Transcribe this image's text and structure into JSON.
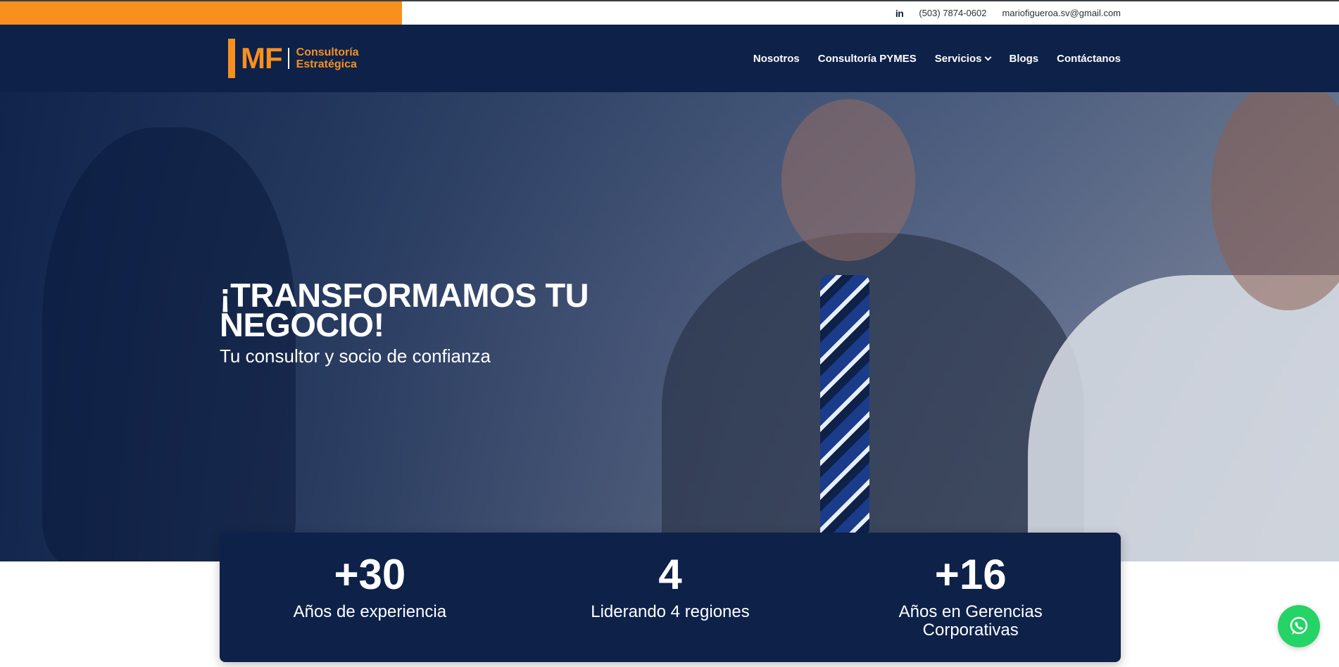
{
  "topbar": {
    "linkedin_icon": "in",
    "phone": "(503) 7874-0602",
    "email": "mariofigueroa.sv@gmail.com"
  },
  "header": {
    "logo": {
      "mark": "MF",
      "line1": "Consultoría",
      "line2": "Estratégica"
    },
    "nav": [
      {
        "label": "Nosotros"
      },
      {
        "label": "Consultoría PYMES"
      },
      {
        "label": "Servicios",
        "has_dropdown": true
      },
      {
        "label": "Blogs"
      },
      {
        "label": "Contáctanos"
      }
    ]
  },
  "hero": {
    "title": "¡TRANSFORMAMOS TU NEGOCIO!",
    "subtitle": "Tu consultor y socio de confianza"
  },
  "stats": [
    {
      "number": "+30",
      "label": "Años de experiencia"
    },
    {
      "number": "4",
      "label": "Liderando 4 regiones"
    },
    {
      "number": "+16",
      "label": "Años en Gerencias Corporativas"
    }
  ],
  "colors": {
    "accent": "#f7901e",
    "navy": "#0d2149",
    "whatsapp": "#25d366"
  },
  "icons": {
    "linkedin": "linkedin-icon",
    "dropdown": "chevron-down-icon",
    "whatsapp": "whatsapp-icon"
  }
}
